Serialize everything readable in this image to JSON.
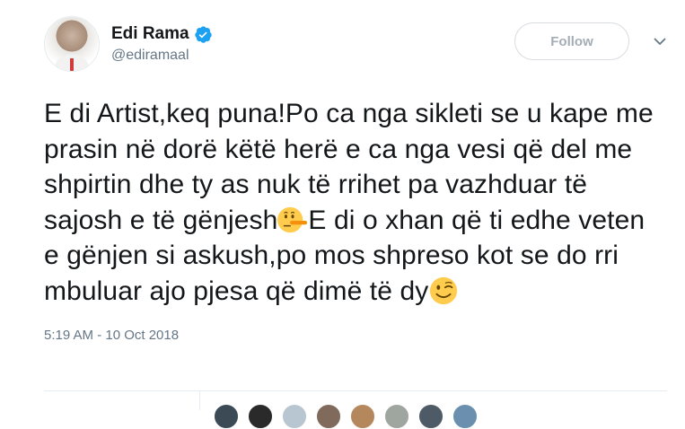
{
  "author": {
    "display_name": "Edi Rama",
    "handle": "@ediramaal",
    "verified": true,
    "avatar_icon": "profile-photo"
  },
  "follow_button": {
    "label": "Follow"
  },
  "menu_icon": "chevron-down-icon",
  "tweet": {
    "segments": [
      "E di Artist,keq puna!Po ca nga sikleti se u kape me prasin në dorë këtë herë e ca nga vesi që del me shpirtin dhe ty as nuk të rrihet pa vazhduar të sajosh e të gënjesh",
      "E di o xhan që ti edhe veten e gënjen si askush,po mos shpreso kot se do rri mbuluar ajo pjesa që dimë të dy"
    ],
    "emojis": [
      "lying-face-emoji",
      "winking-face-emoji"
    ],
    "timestamp": "5:19 AM - 10 Oct 2018"
  },
  "colors": {
    "text": "#14171a",
    "secondary": "#657786",
    "verified_blue": "#1da1f2",
    "border": "#e6ecf0"
  },
  "liker_avatar_colors": [
    "#3b4a55",
    "#2a2a2a",
    "#b8c6d1",
    "#7f6a5b",
    "#b4875c",
    "#9fa6a0",
    "#4e5b66",
    "#6b8fae"
  ]
}
